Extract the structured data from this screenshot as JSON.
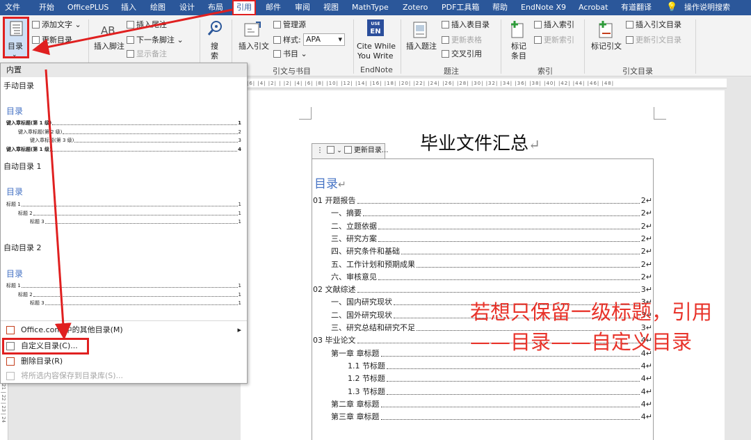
{
  "menubar": {
    "tabs": [
      "文件",
      "开始",
      "OfficePLUS",
      "插入",
      "绘图",
      "设计",
      "布局",
      "引用",
      "邮件",
      "审阅",
      "视图",
      "MathType",
      "Zotero",
      "PDF工具箱",
      "帮助",
      "EndNote X9",
      "Acrobat",
      "有道翻译"
    ],
    "active_tab": "引用",
    "tell_me": "操作说明搜索"
  },
  "ribbon": {
    "toc": {
      "button": "目录",
      "add_text": "添加文字",
      "update_toc": "更新目录"
    },
    "footnotes": {
      "ab_icon": "AB",
      "insert_footnote": "插入脚注",
      "insert_endnote": "插入尾注",
      "next_footnote": "下一条脚注",
      "show_notes": "显示备注"
    },
    "research": {
      "search": "搜",
      "search2": "索"
    },
    "citations": {
      "insert_citation": "插入引文",
      "manage_sources": "管理源",
      "style_label": "样式:",
      "style_value": "APA",
      "bibliography": "书目",
      "group": "引文与书目"
    },
    "endnote": {
      "badge_top": "USE",
      "badge": "EN",
      "cite": "Cite While",
      "cite2": "You Write",
      "group": "EndNote"
    },
    "captions": {
      "insert_caption": "插入题注",
      "insert_table_of_figures": "插入表目录",
      "update_table": "更新表格",
      "cross_reference": "交叉引用",
      "group": "题注"
    },
    "index": {
      "mark_entry": "标记",
      "mark_entry2": "条目",
      "insert_index": "插入索引",
      "update_index": "更新索引",
      "group": "索引"
    },
    "authorities": {
      "mark_citation": "标记引文",
      "insert_toa": "插入引文目录",
      "update_toa": "更新引文目录",
      "group": "引文目录"
    }
  },
  "ruler_text": "|6| |4| |2| | |2| |4| |6| |8| |10| |12| |14| |16| |18| |20| |22| |24| |26| |28| |30| |32| |34| |36| |38| |40| |42| |44| |46| |48|",
  "vruler_text": "21 | 22 | 23 | 24",
  "dropdown": {
    "builtin": "内置",
    "manual": {
      "name": "手动目录",
      "title": "目录",
      "entries": [
        {
          "text": "键入章标题(第 1 级)",
          "page": "1",
          "level": 1
        },
        {
          "text": "键入章标题(第 2 级)",
          "page": "2",
          "level": 2
        },
        {
          "text": "键入章标题(第 3 级)",
          "page": "3",
          "level": 3
        },
        {
          "text": "键入章标题(第 1 级)",
          "page": "4",
          "level": 1
        }
      ]
    },
    "auto1": {
      "name": "自动目录 1",
      "title": "目录",
      "entries": [
        {
          "text": "标题 1",
          "page": "1",
          "level": 1
        },
        {
          "text": "标题 2",
          "page": "1",
          "level": 2
        },
        {
          "text": "标题 3",
          "page": "1",
          "level": 3
        }
      ]
    },
    "auto2": {
      "name": "自动目录 2",
      "title": "目录",
      "entries": [
        {
          "text": "标题 1",
          "page": "1",
          "level": 1
        },
        {
          "text": "标题 2",
          "page": "1",
          "level": 2
        },
        {
          "text": "标题 3",
          "page": "1",
          "level": 3
        }
      ]
    },
    "menu": {
      "more": "Office.com 中的其他目录(M)",
      "more_arrow": "▸",
      "custom": "自定义目录(C)...",
      "remove": "删除目录(R)",
      "save": "将所选内容保存到目录库(S)..."
    }
  },
  "document": {
    "title": "毕业文件汇总",
    "return_mark": "↵",
    "cc_update": "更新目录...",
    "toc_heading": "目录",
    "toc_entries": [
      {
        "text": "01 开题报告",
        "page": "2",
        "level": 1
      },
      {
        "text": "一、摘要",
        "page": "2",
        "level": 2
      },
      {
        "text": "二、立题依据",
        "page": "2",
        "level": 2
      },
      {
        "text": "三、研究方案",
        "page": "2",
        "level": 2
      },
      {
        "text": "四、研究条件和基础",
        "page": "2",
        "level": 2
      },
      {
        "text": "五、工作计划和预期成果",
        "page": "2",
        "level": 2
      },
      {
        "text": "六、审核意见",
        "page": "2",
        "level": 2
      },
      {
        "text": "02 文献综述",
        "page": "3",
        "level": 1
      },
      {
        "text": "一、国内研究现状",
        "page": "3",
        "level": 2
      },
      {
        "text": "二、国外研究现状",
        "page": "3",
        "level": 2
      },
      {
        "text": "三、研究总结和研究不足",
        "page": "3",
        "level": 2
      },
      {
        "text": "03 毕业论文",
        "page": "4",
        "level": 1
      },
      {
        "text": "第一章 章标题",
        "page": "4",
        "level": 2
      },
      {
        "text": "1.1 节标题",
        "page": "4",
        "level": 3
      },
      {
        "text": "1.2 节标题",
        "page": "4",
        "level": 3
      },
      {
        "text": "1.3 节标题",
        "page": "4",
        "level": 3
      },
      {
        "text": "第二章 章标题",
        "page": "4",
        "level": 2
      },
      {
        "text": "第三章 章标题",
        "page": "4",
        "level": 2
      }
    ],
    "annotation_line1": "若想只保留一级标题，引用",
    "annotation_line2": "——目录——自定义目录"
  },
  "colors": {
    "menubar": "#2b579a",
    "highlight": "#e02020",
    "toc_heading": "#4472c4",
    "annotation": "#e8332a"
  }
}
